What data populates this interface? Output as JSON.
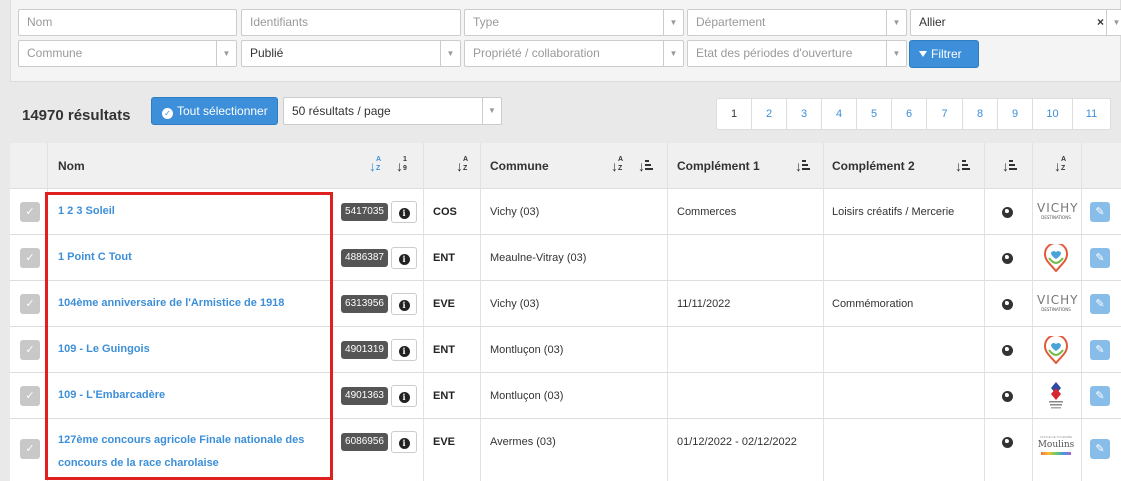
{
  "filters": {
    "nom_placeholder": "Nom",
    "identifiants_placeholder": "Identifiants",
    "type_placeholder": "Type",
    "departement_placeholder": "Département",
    "departement2_value": "Allier",
    "departement2_clear": "×",
    "commune_placeholder": "Commune",
    "statut_value": "Publié",
    "propriete_placeholder": "Propriété / collaboration",
    "periodes_placeholder": "Etat des périodes d'ouverture",
    "filter_button": "Filtrer"
  },
  "results": {
    "count_label": "14970 résultats",
    "select_all_label": "Tout sélectionner",
    "per_page_value": "50 résultats / page"
  },
  "pagination": {
    "pages": [
      "1",
      "2",
      "3",
      "4",
      "5",
      "6",
      "7",
      "8",
      "9",
      "10",
      "11"
    ],
    "active": "1"
  },
  "table": {
    "headers": {
      "nom": "Nom",
      "commune": "Commune",
      "complement1": "Complément 1",
      "complement2": "Complément 2"
    },
    "sort_labels": {
      "az_top": "A",
      "az_bottom": "Z",
      "num_top": "1",
      "num_bottom": "9"
    },
    "rows": [
      {
        "name": "1 2 3 Soleil",
        "id": "5417035",
        "type": "COS",
        "commune": "Vichy (03)",
        "c1": "Commerces",
        "c2": "Loisirs créatifs / Mercerie",
        "logo": "vichy-destinations-logo"
      },
      {
        "name": "1 Point C Tout",
        "id": "4886387",
        "type": "ENT",
        "commune": "Meaulne-Vitray (03)",
        "c1": "",
        "c2": "",
        "logo": "heart-location-logo"
      },
      {
        "name": "104ème anniversaire de l'Armistice de 1918",
        "id": "6313956",
        "type": "EVE",
        "commune": "Vichy (03)",
        "c1": "11/11/2022",
        "c2": "Commémoration",
        "logo": "vichy-destinations-logo"
      },
      {
        "name": "109 - Le Guingois",
        "id": "4901319",
        "type": "ENT",
        "commune": "Montluçon (03)",
        "c1": "",
        "c2": "",
        "logo": "heart-location-logo"
      },
      {
        "name": "109 - L'Embarcadère",
        "id": "4901363",
        "type": "ENT",
        "commune": "Montluçon (03)",
        "c1": "",
        "c2": "",
        "logo": "offices-tourisme-logo"
      },
      {
        "name": "127ème concours agricole Finale nationale des concours de la race charolaise",
        "id": "6086956",
        "type": "EVE",
        "commune": "Avermes (03)",
        "c1": "01/12/2022 - 02/12/2022",
        "c2": "",
        "logo": "moulins-logo"
      }
    ]
  },
  "logos": {
    "vichy_big": "VICHY",
    "vichy_small": "DESTINATIONS",
    "moulins_top": "OFFICE DE TOURISME",
    "moulins_name": "Moulins"
  },
  "colors": {
    "accent": "#3c8fd8",
    "highlight": "#e01f1f",
    "id_badge": "#555555"
  }
}
